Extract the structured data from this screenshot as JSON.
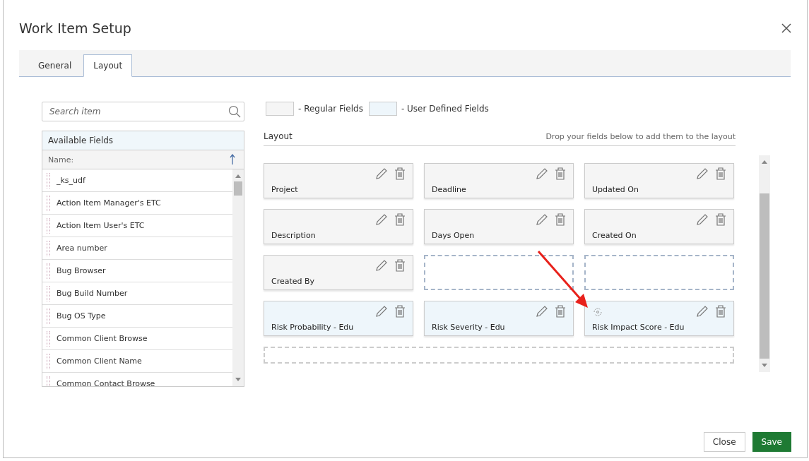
{
  "window": {
    "title": "Work Item Setup"
  },
  "tabs": [
    {
      "label": "General",
      "selected": false
    },
    {
      "label": "Layout",
      "selected": true
    }
  ],
  "search": {
    "placeholder": "Search item"
  },
  "available_fields": {
    "title": "Available Fields",
    "column": "Name:",
    "items": [
      "_ks_udf",
      "Action Item Manager's ETC",
      "Action Item User's ETC",
      "Area number",
      "Bug Browser",
      "Bug Build Number",
      "Bug OS Type",
      "Common Client Browse",
      "Common Client Name",
      "Common Contact Browse"
    ]
  },
  "legend": [
    {
      "kind": "regular",
      "label": "- Regular Fields"
    },
    {
      "kind": "user_defined",
      "label": "- User Defined Fields"
    }
  ],
  "layout": {
    "title": "Layout",
    "hint": "Drop your fields below to add them to the layout",
    "rows": [
      [
        {
          "kind": "regular",
          "label": "Project"
        },
        {
          "kind": "regular",
          "label": "Deadline"
        },
        {
          "kind": "regular",
          "label": "Updated On"
        }
      ],
      [
        {
          "kind": "regular",
          "label": "Description"
        },
        {
          "kind": "regular",
          "label": "Days Open"
        },
        {
          "kind": "regular",
          "label": "Created On"
        }
      ],
      [
        {
          "kind": "regular",
          "label": "Created By"
        },
        {
          "kind": "empty"
        },
        {
          "kind": "empty"
        }
      ],
      [
        {
          "kind": "user_defined",
          "label": "Risk Probability - Edu"
        },
        {
          "kind": "user_defined",
          "label": "Risk Severity - Edu"
        },
        {
          "kind": "user_defined",
          "label": "Risk Impact Score - Edu",
          "calculated": true
        }
      ]
    ]
  },
  "buttons": [
    {
      "label": "Close",
      "kind": "secondary"
    },
    {
      "label": "Save",
      "kind": "primary"
    }
  ]
}
